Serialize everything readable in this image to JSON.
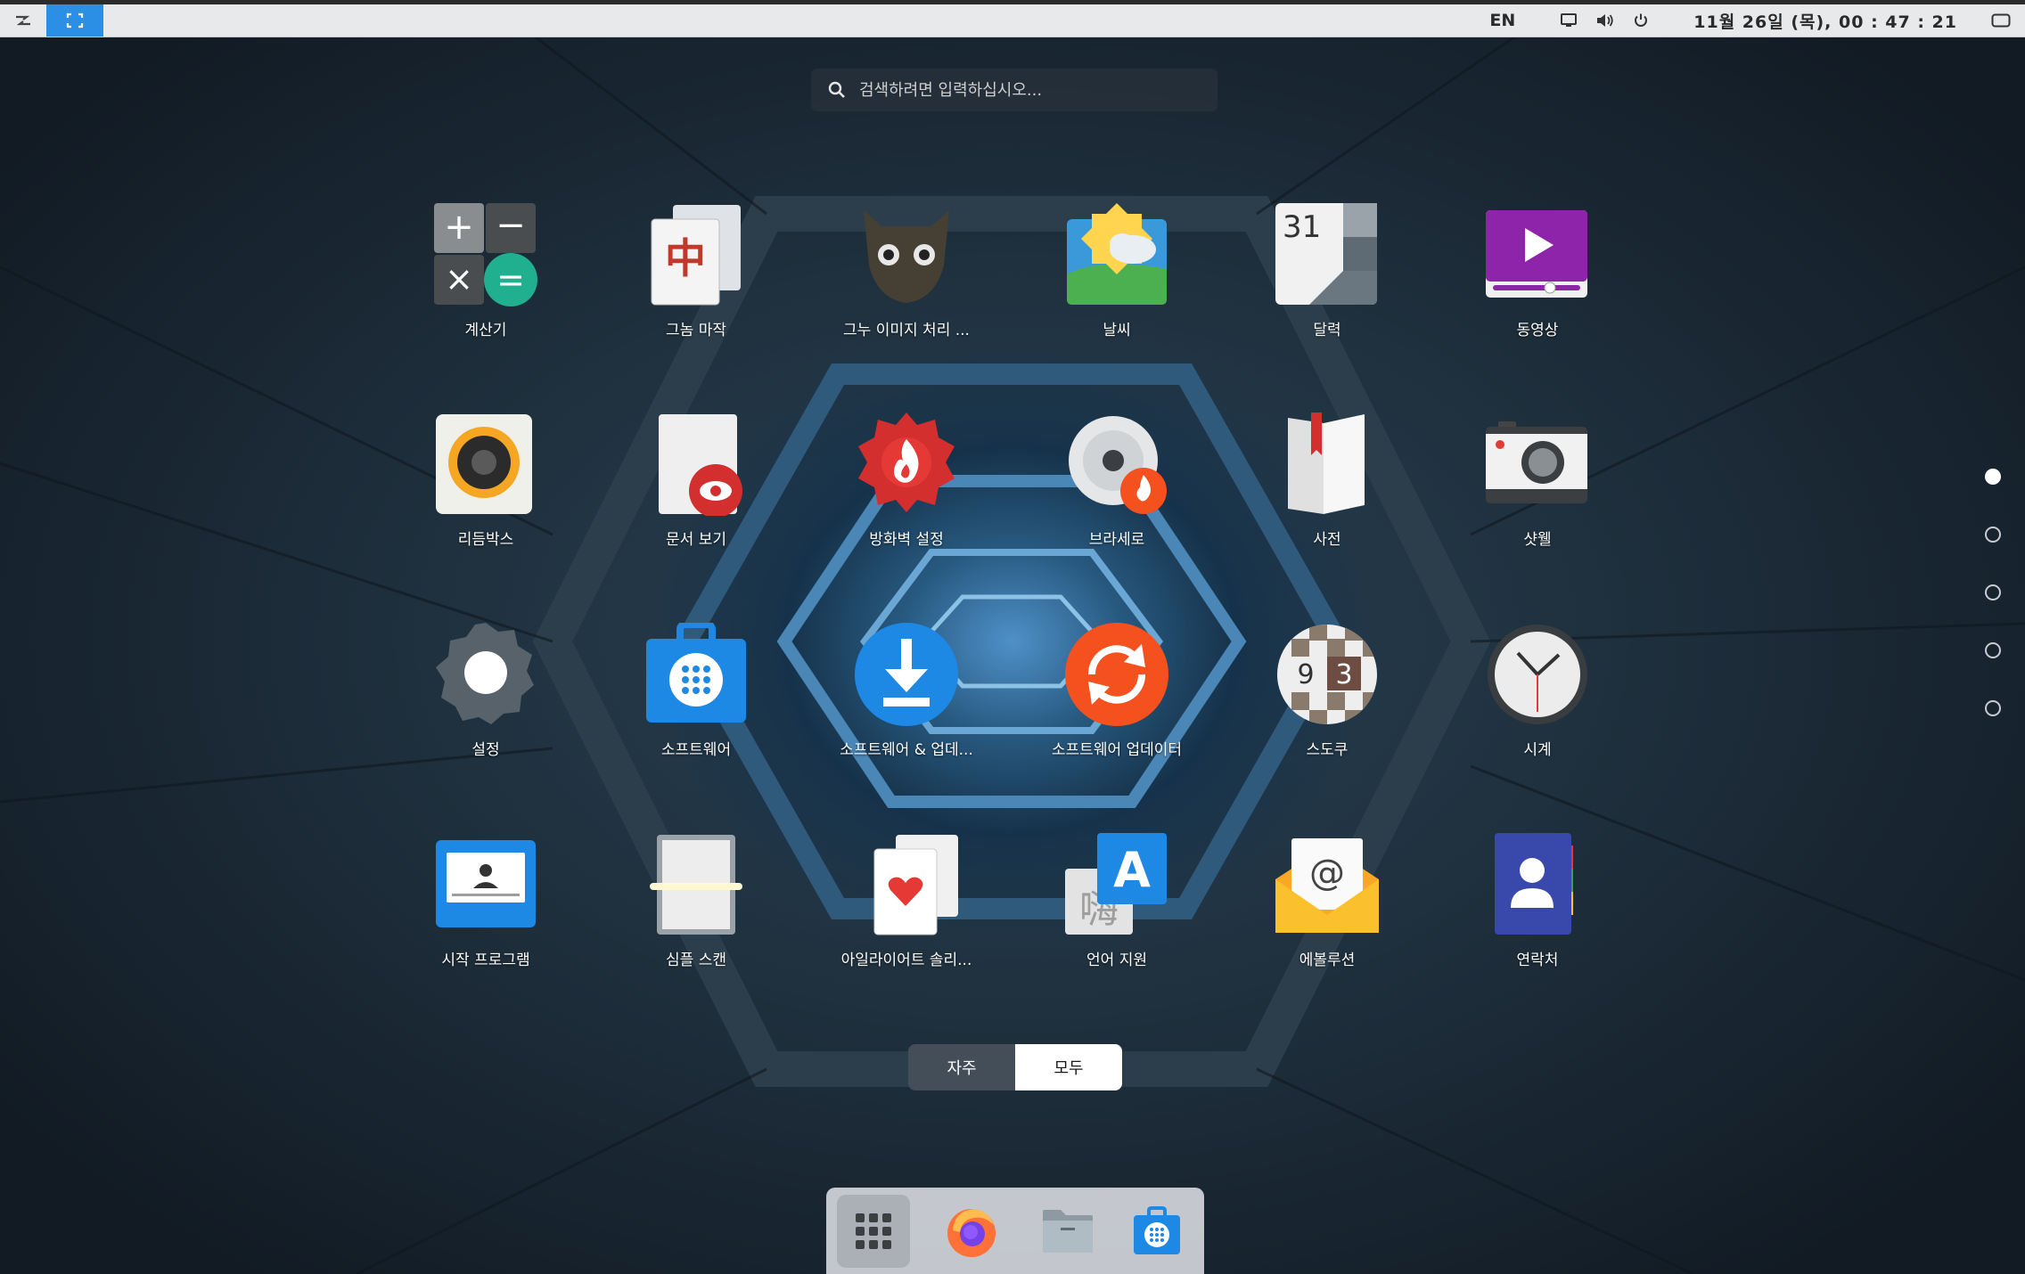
{
  "top_panel": {
    "language": "EN",
    "clock": "11월 26일 (목), 00 : 47 : 21"
  },
  "search": {
    "placeholder": "검색하려면 입력하십시오..."
  },
  "apps": [
    {
      "label": "계산기",
      "icon": "calculator-icon"
    },
    {
      "label": "그놈 마작",
      "icon": "mahjong-icon"
    },
    {
      "label": "그누 이미지 처리 ...",
      "icon": "gimp-icon"
    },
    {
      "label": "날씨",
      "icon": "weather-icon"
    },
    {
      "label": "달력",
      "icon": "calendar-icon"
    },
    {
      "label": "동영상",
      "icon": "video-icon"
    },
    {
      "label": "리듬박스",
      "icon": "rhythmbox-icon"
    },
    {
      "label": "문서 보기",
      "icon": "document-viewer-icon"
    },
    {
      "label": "방화벽 설정",
      "icon": "firewall-icon"
    },
    {
      "label": "브라세로",
      "icon": "brasero-icon"
    },
    {
      "label": "사전",
      "icon": "dictionary-icon"
    },
    {
      "label": "샷웰",
      "icon": "shotwell-icon"
    },
    {
      "label": "설정",
      "icon": "settings-icon"
    },
    {
      "label": "소프트웨어",
      "icon": "software-icon"
    },
    {
      "label": "소프트웨어 & 업데...",
      "icon": "software-update-download-icon"
    },
    {
      "label": "소프트웨어 업데이터",
      "icon": "software-updater-icon"
    },
    {
      "label": "스도쿠",
      "icon": "sudoku-icon"
    },
    {
      "label": "시계",
      "icon": "clock-icon"
    },
    {
      "label": "시작 프로그램",
      "icon": "startup-apps-icon"
    },
    {
      "label": "심플 스캔",
      "icon": "simple-scan-icon"
    },
    {
      "label": "아일라이어트 솔리...",
      "icon": "solitaire-icon"
    },
    {
      "label": "언어 지원",
      "icon": "language-support-icon"
    },
    {
      "label": "에볼루션",
      "icon": "evolution-icon"
    },
    {
      "label": "연락처",
      "icon": "contacts-icon"
    }
  ],
  "calendar_icon_day": "31",
  "sudoku_digits": [
    "9",
    "3"
  ],
  "language_icon_letters": {
    "latin": "A",
    "hanzi": "嗨"
  },
  "pages": {
    "total": 5,
    "current": 1
  },
  "category_toggle": {
    "frequent_label": "자주",
    "all_label": "모두",
    "selected": "모두"
  },
  "dock": {
    "items": [
      "app-launcher-icon",
      "firefox-icon",
      "files-icon",
      "software-store-icon"
    ]
  },
  "colors": {
    "accent": "#2b8fe5",
    "panel_bg": "#e8e9eb"
  }
}
